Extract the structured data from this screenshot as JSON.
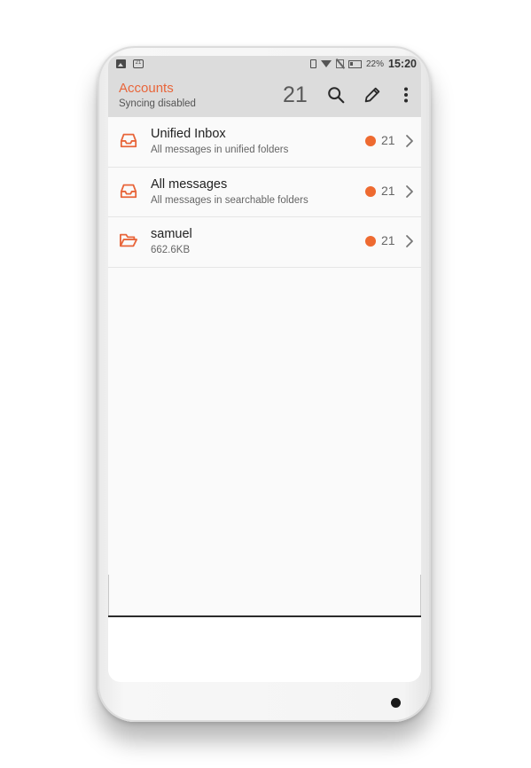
{
  "status_bar": {
    "battery_pct": "22%",
    "time": "15:20",
    "calendar_day": "21",
    "icons": [
      "image-icon",
      "calendar-icon",
      "vibrate-icon",
      "wifi-icon",
      "no-sim-icon",
      "battery-icon"
    ]
  },
  "appbar": {
    "title": "Accounts",
    "subtitle": "Syncing disabled",
    "unread_count": "21",
    "icons": [
      "search-icon",
      "pencil-icon",
      "more-vert-icon"
    ]
  },
  "accounts": [
    {
      "title": "Unified Inbox",
      "subtitle": "All messages in unified folders",
      "count": "21",
      "icon": "inbox-icon"
    },
    {
      "title": "All messages",
      "subtitle": "All messages in searchable folders",
      "count": "21",
      "icon": "inbox-icon"
    },
    {
      "title": "samuel",
      "subtitle": "662.6KB",
      "count": "21",
      "icon": "folder-open-icon"
    }
  ],
  "colors": {
    "accent": "#e8653a",
    "unread_dot": "#ee6a30",
    "appbar_bg": "#dcdcdc",
    "list_bg": "#fafafa"
  }
}
